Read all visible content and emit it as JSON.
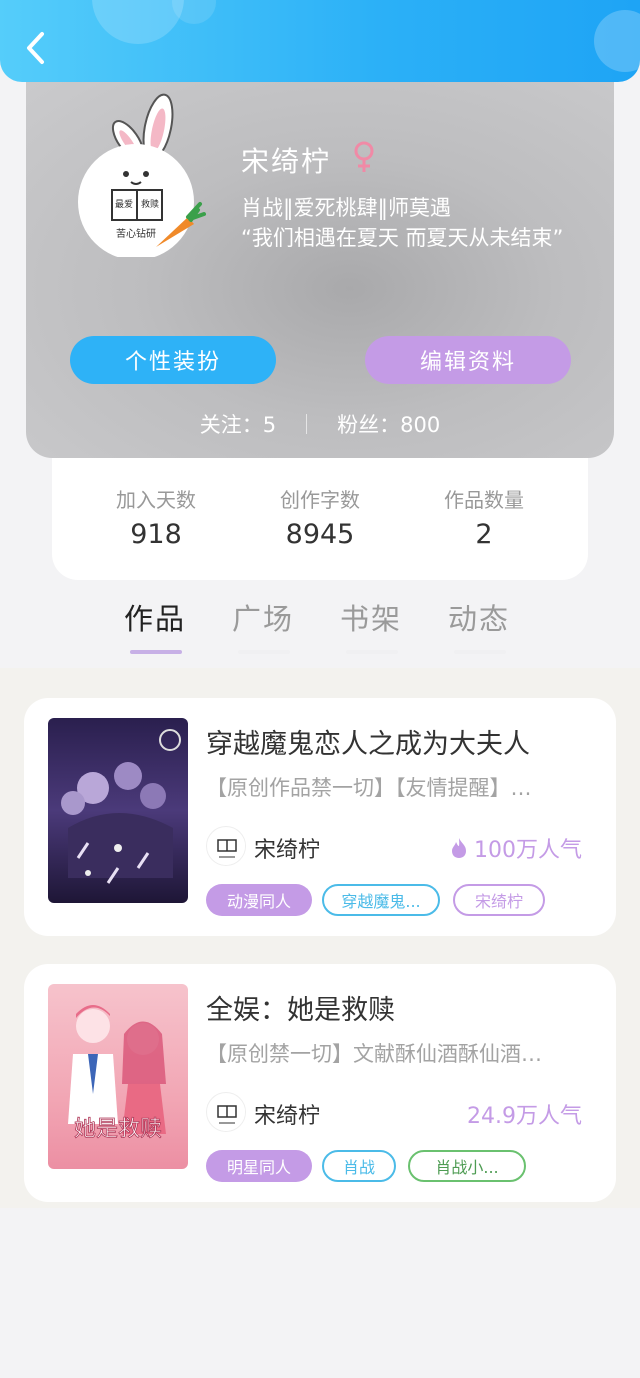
{
  "header": {
    "back_icon": "chevron-left-icon",
    "accent": "#2bb0f7"
  },
  "profile": {
    "nickname": "宋绮柠",
    "gender_icon": "female-icon",
    "gender_color": "#f08aa6",
    "avatar_text_a": "最爱",
    "avatar_text_b": "救赎",
    "avatar_caption": "苦心钻研",
    "tags": "肖战‖爱死桃肆‖师莫遇",
    "motto": "“我们相遇在夏天 而夏天从未结束”",
    "dress_button": "个性装扮",
    "edit_button": "编辑资料",
    "follow_label": "关注：5",
    "fans_label": "粉丝：800"
  },
  "stats": [
    {
      "label": "加入天数",
      "value": "918"
    },
    {
      "label": "创作字数",
      "value": "8945"
    },
    {
      "label": "作品数量",
      "value": "2"
    }
  ],
  "tabs": [
    {
      "label": "作品",
      "active": true
    },
    {
      "label": "广场",
      "active": false
    },
    {
      "label": "书架",
      "active": false
    },
    {
      "label": "动态",
      "active": false
    }
  ],
  "works": [
    {
      "title": "穿越魔鬼恋人之成为大夫人",
      "desc": "【原创作品禁一切】【友情提醒】…",
      "author": "宋绮柠",
      "popularity": "100万人气",
      "pop_icon": "flame-icon",
      "chips": [
        "动漫同人",
        "穿越魔鬼...",
        "宋绮柠"
      ]
    },
    {
      "title": "全娱：她是救赎",
      "desc": "【原创禁一切】文献酥仙酒酥仙酒…",
      "author": "宋绮柠",
      "popularity": "24.9万人气",
      "cover_text": "她是救赎",
      "chips": [
        "明星同人",
        "肖战",
        "肖战小..."
      ]
    }
  ]
}
